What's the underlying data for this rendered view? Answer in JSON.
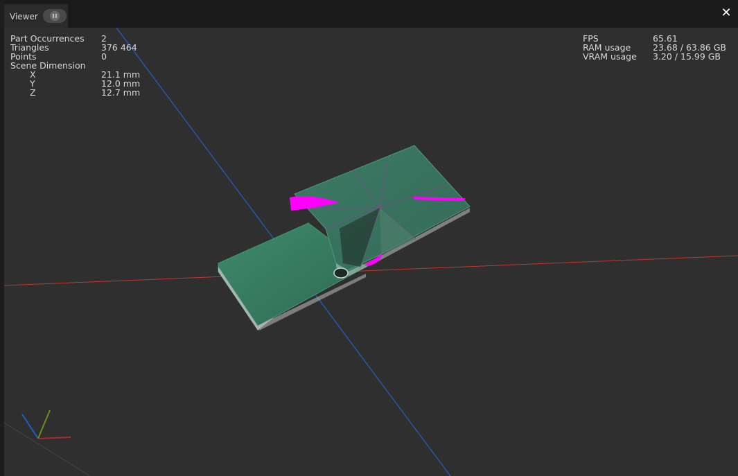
{
  "tab": {
    "title": "Viewer"
  },
  "stats_left": {
    "part_occurrences_label": "Part Occurrences",
    "part_occurrences_value": "2",
    "triangles_label": "Triangles",
    "triangles_value": "376 464",
    "points_label": "Points",
    "points_value": "0",
    "scene_dimension_label": "Scene Dimension",
    "x_label": "X",
    "x_value": "21.1 mm",
    "y_label": "Y",
    "y_value": "12.0 mm",
    "z_label": "Z",
    "z_value": "12.7 mm"
  },
  "stats_right": {
    "fps_label": "FPS",
    "fps_value": "65.61",
    "ram_label": "RAM usage",
    "ram_value": "23.68 / 63.86 GB",
    "vram_label": "VRAM usage",
    "vram_value": "3.20 / 15.99 GB"
  },
  "colors": {
    "x_axis": "#c0392b",
    "y_axis": "#6a8f1f",
    "z_axis": "#1f5fbf",
    "model_green": "#2f6e57",
    "highlight": "#ff00ff"
  },
  "icons": {
    "pause": "pause-icon",
    "close": "close-icon"
  }
}
